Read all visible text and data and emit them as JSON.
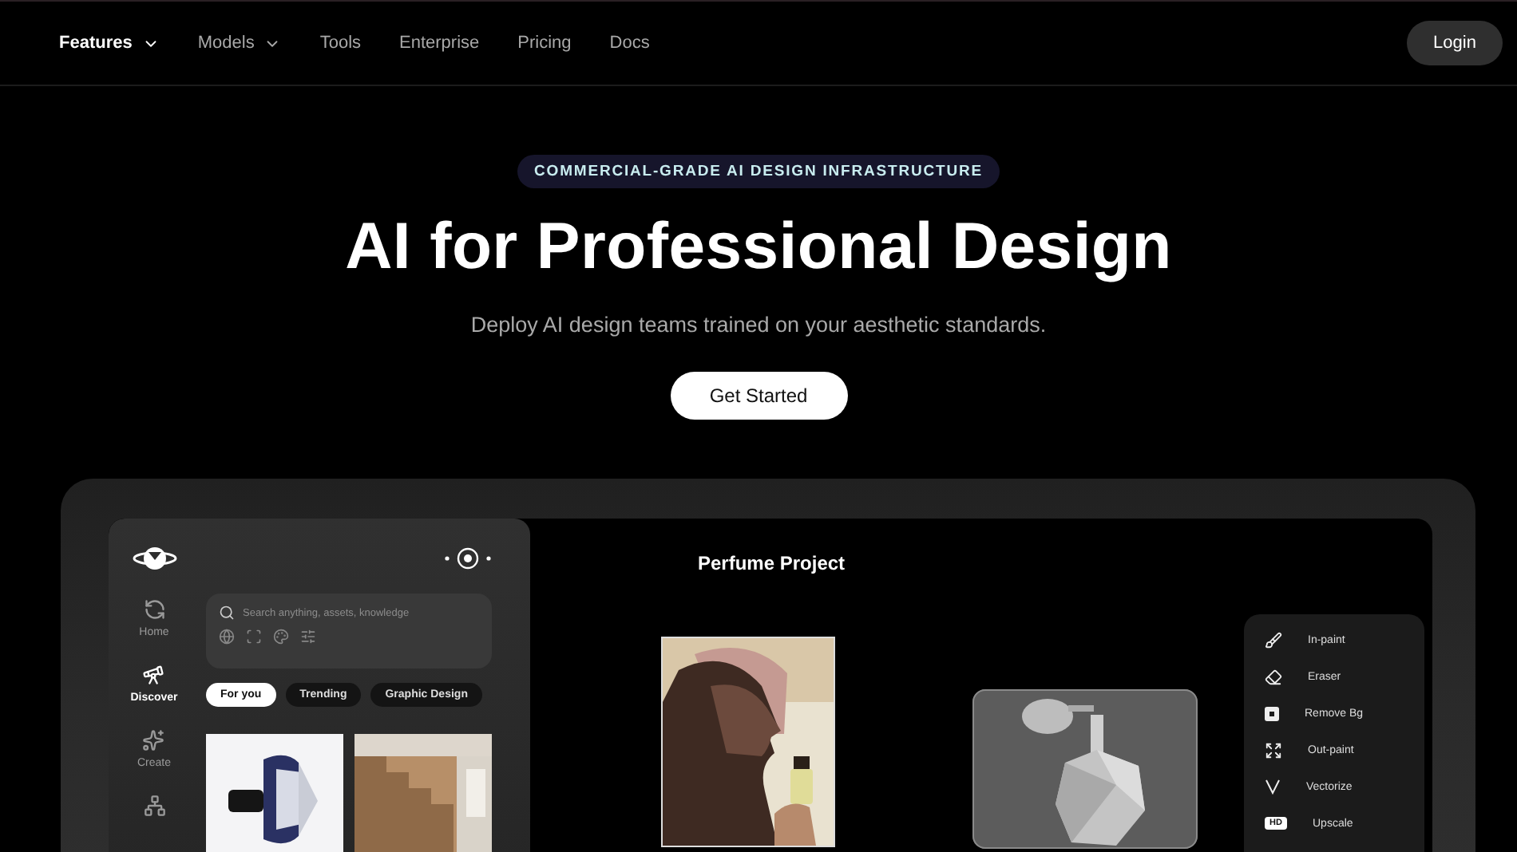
{
  "nav": {
    "items": [
      {
        "label": "Features",
        "dropdown": true,
        "selected": true
      },
      {
        "label": "Models",
        "dropdown": true,
        "selected": false
      },
      {
        "label": "Tools",
        "dropdown": false,
        "selected": false
      },
      {
        "label": "Enterprise",
        "dropdown": false,
        "selected": false
      },
      {
        "label": "Pricing",
        "dropdown": false,
        "selected": false
      },
      {
        "label": "Docs",
        "dropdown": false,
        "selected": false
      }
    ],
    "login": "Login"
  },
  "hero": {
    "badge": "COMMERCIAL-GRADE AI DESIGN INFRASTRUCTURE",
    "title": "AI for Professional Design",
    "subtitle": "Deploy AI design teams trained on your aesthetic standards.",
    "cta": "Get Started"
  },
  "app": {
    "sidebar": [
      {
        "kind": "home",
        "label": "Home",
        "selected": false
      },
      {
        "kind": "discover",
        "label": "Discover",
        "selected": true
      },
      {
        "kind": "create",
        "label": "Create",
        "selected": false
      },
      {
        "kind": "agent",
        "selected": false
      }
    ],
    "search": {
      "placeholder": "Search anything, assets, knowledge"
    },
    "chips": [
      {
        "label": "For you",
        "selected": true
      },
      {
        "label": "Trending",
        "selected": false
      },
      {
        "label": "Graphic Design",
        "selected": false
      }
    ]
  },
  "canvas": {
    "title": "Perfume Project",
    "tools": [
      {
        "kind": "inpaint",
        "label": "In-paint"
      },
      {
        "kind": "eraser",
        "label": "Eraser"
      },
      {
        "kind": "remove_bg",
        "label": "Remove Bg"
      },
      {
        "kind": "outpaint",
        "label": "Out-paint"
      },
      {
        "kind": "vectorize",
        "label": "Vectorize"
      },
      {
        "kind": "upscale",
        "label": "Upscale",
        "icon_text": "HD"
      }
    ]
  }
}
